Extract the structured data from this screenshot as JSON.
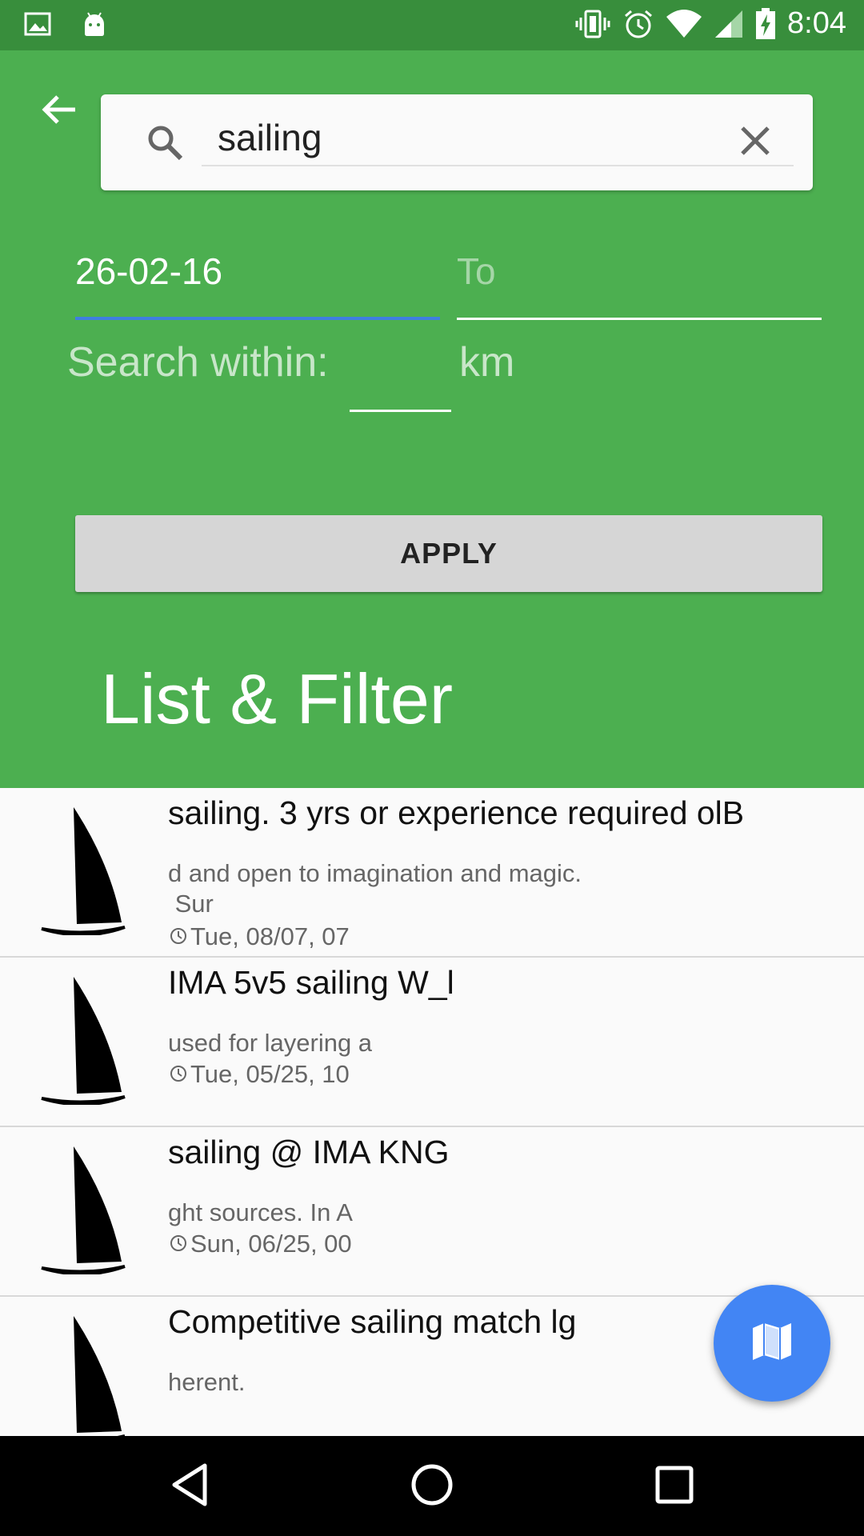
{
  "status_bar": {
    "time": "8:04",
    "left_icons": [
      "image-icon",
      "android-icon"
    ],
    "right_icons": [
      "vibrate-icon",
      "alarm-icon",
      "wifi-icon",
      "signal-icon",
      "battery-charging-icon"
    ]
  },
  "search": {
    "value": "sailing",
    "back_icon": "arrow-left-icon",
    "search_icon": "search-icon",
    "clear_icon": "close-icon"
  },
  "filters": {
    "date_from": "26-02-16",
    "date_to_placeholder": "To",
    "within_label": "Search within:",
    "within_value": "",
    "unit_label": "km",
    "apply_label": "APPLY"
  },
  "page_title": "List & Filter",
  "results": [
    {
      "title": "sailing. 3 yrs or experience required olB",
      "description": "d and open to imagination and magic.\n Sur",
      "date": "Tue, 08/07, 07"
    },
    {
      "title": "IMA 5v5 sailing W_l",
      "description": "used for layering a",
      "date": "Tue, 05/25, 10"
    },
    {
      "title": "sailing @ IMA KNG",
      "description": "ght sources. In A",
      "date": "Sun, 06/25, 00"
    },
    {
      "title": "Competitive sailing match lg",
      "description": "herent.",
      "date": ""
    }
  ],
  "fab_icon": "map-icon",
  "nav": {
    "back_icon": "nav-back-icon",
    "home_icon": "nav-home-icon",
    "recents_icon": "nav-recents-icon"
  },
  "colors": {
    "status_bar": "#388e3c",
    "header": "#4caf50",
    "accent": "#3f7fe0",
    "fab": "#4285f4"
  }
}
